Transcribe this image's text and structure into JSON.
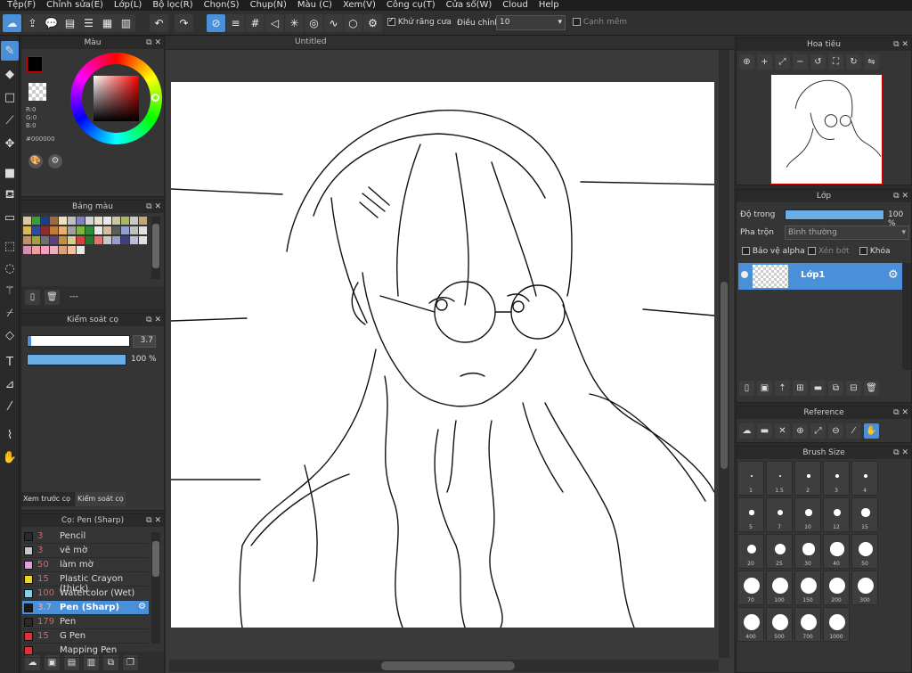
{
  "menu": [
    "Tệp(F)",
    "Chỉnh sửa(E)",
    "Lớp(L)",
    "Bộ lọc(R)",
    "Chọn(S)",
    "Chụp(N)",
    "Màu (C)",
    "Xem(V)",
    "Công cụ(T)",
    "Cửa sổ(W)",
    "Cloud",
    "Help"
  ],
  "toolbar": {
    "antialias_label": "Khử răng cưa",
    "adjust_label": "Điều chỉnh",
    "adjust_value": "10",
    "edge_label": "Cạnh mềm"
  },
  "color_panel": {
    "title": "Màu",
    "r": "R:0",
    "g": "G:0",
    "b": "B:0",
    "hex": "#000000"
  },
  "palette_panel": {
    "title": "Bảng màu",
    "footer": "---",
    "swatches": [
      "#d8c8a0",
      "#3c9c3c",
      "#1c3c8c",
      "#9c6c3c",
      "#f0e0c0",
      "#c0c0c0",
      "#8080c0",
      "#d4d4d4",
      "#e8e0c8",
      "#e8e8e8",
      "#c8c8a0",
      "#a8b860",
      "#c8c8c8",
      "#c0a878",
      "#d8b858",
      "#2c4c9c",
      "#8c2c2c",
      "#c07c3c",
      "#e8b070",
      "#a0a0a0",
      "#7cb840",
      "#2c8c3c",
      "#e8e8e8",
      "#d0c0a0",
      "#5c5c5c",
      "#90a0d0",
      "#c0c0c0",
      "#e0e0e0",
      "#c09068",
      "#a0a040",
      "#707070",
      "#5c4080",
      "#c09040",
      "#d0d090",
      "#d84040",
      "#1c7c2c",
      "#e87070",
      "#c8c8c8",
      "#9c9cc8",
      "#404080",
      "#bcbcd8",
      "#e0e0e0",
      "#d890b0",
      "#e8a0a0",
      "#f0a0c0",
      "#e8b0c0",
      "#d8a080",
      "#f0c0a0",
      "#e8e8e8"
    ]
  },
  "brush_control": {
    "title": "Kiểm soát cọ",
    "size": "3.7",
    "opacity": "100 %",
    "size_fill": 1.0,
    "opacity_fill": 1.0
  },
  "tabs": {
    "preview": "Xem trước cọ",
    "control": "Kiểm soát cọ"
  },
  "brush_list": {
    "title": "Cọ: Pen (Sharp)",
    "items": [
      {
        "num": "3",
        "label": "Pencil",
        "color": "#2a2a2a"
      },
      {
        "num": "3",
        "label": "vẽ mờ",
        "color": "#c8c8c8"
      },
      {
        "num": "50",
        "label": "làm mờ",
        "color": "#e0a0e0"
      },
      {
        "num": "15",
        "label": "Plastic Crayon (thick)",
        "color": "#e8d820"
      },
      {
        "num": "100",
        "label": "Watercolor (Wet)",
        "color": "#80d0f0"
      },
      {
        "num": "3.7",
        "label": "Pen (Sharp)",
        "color": "#1a1a1a",
        "selected": true
      },
      {
        "num": "179",
        "label": "Pen",
        "color": "#2a2a2a"
      },
      {
        "num": "15",
        "label": "G Pen",
        "color": "#e03030"
      },
      {
        "num": "",
        "label": "Mapping Pen",
        "color": "#e03030"
      }
    ]
  },
  "document": {
    "title": "Untitled"
  },
  "navigator": {
    "title": "Hoa tiêu"
  },
  "layer_panel": {
    "title": "Lớp",
    "opacity_label": "Độ trong",
    "opacity_value": "100 %",
    "opacity_fill": 1.0,
    "blend_label": "Pha trộn",
    "blend_value": "Bình thường",
    "protect_alpha": "Bảo vệ alpha",
    "clipping": "Xén bớt",
    "lock": "Khóa",
    "layer_name": "Lớp1"
  },
  "reference_panel": {
    "title": "Reference"
  },
  "brush_size_panel": {
    "title": "Brush Size",
    "sizes": [
      "1",
      "1.5",
      "2",
      "3",
      "4",
      "5",
      "7",
      "10",
      "12",
      "15",
      "20",
      "25",
      "30",
      "40",
      "50",
      "70",
      "100",
      "150",
      "200",
      "300",
      "400",
      "500",
      "700",
      "1000"
    ]
  }
}
